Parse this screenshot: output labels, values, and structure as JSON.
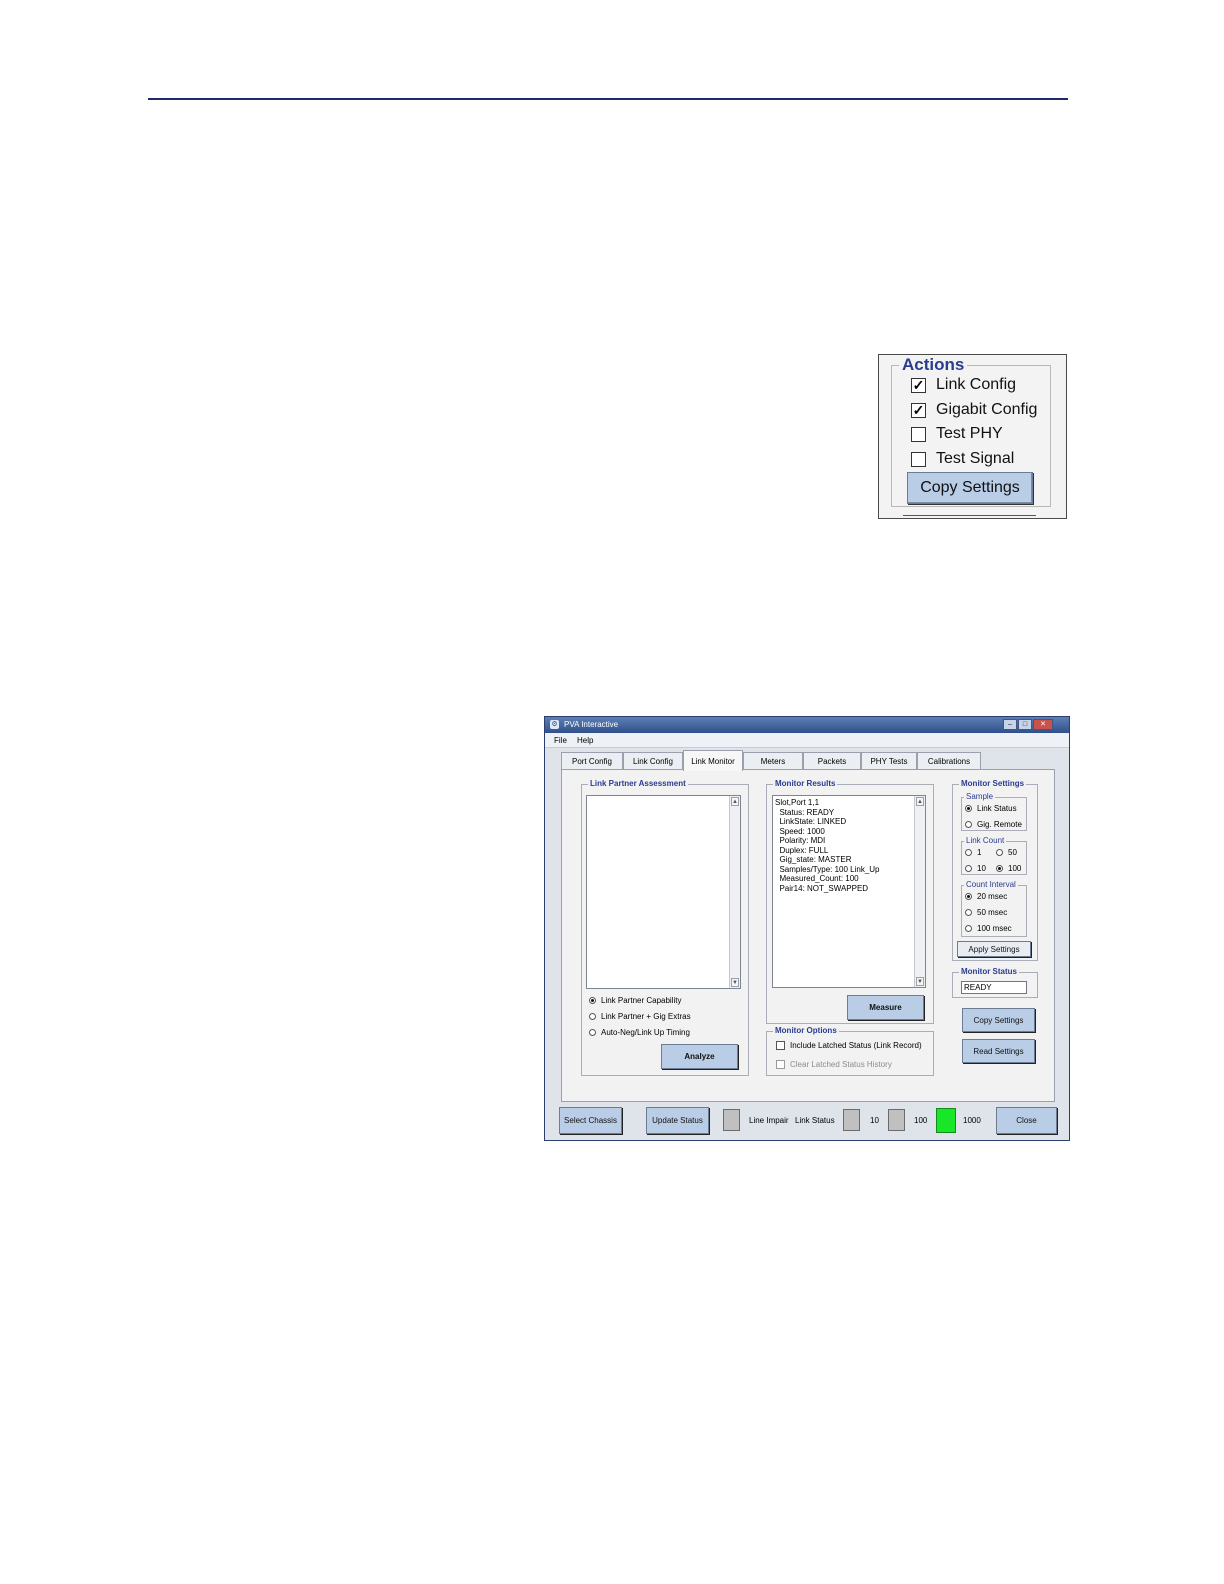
{
  "actions_panel": {
    "legend": "Actions",
    "items": [
      {
        "label": "Link Config",
        "checked": true
      },
      {
        "label": "Gigabit Config",
        "checked": true
      },
      {
        "label": "Test PHY",
        "checked": false
      },
      {
        "label": "Test Signal",
        "checked": false
      }
    ],
    "copy_button": "Copy Settings"
  },
  "window": {
    "title": "PVA Interactive",
    "menu": [
      "File",
      "Help"
    ],
    "tabs": [
      {
        "label": "Port Config",
        "active": false
      },
      {
        "label": "Link Config",
        "active": false
      },
      {
        "label": "Link Monitor",
        "active": true
      },
      {
        "label": "Meters",
        "active": false
      },
      {
        "label": "Packets",
        "active": false
      },
      {
        "label": "PHY Tests",
        "active": false
      },
      {
        "label": "Calibrations",
        "active": false
      }
    ],
    "link_partner": {
      "title": "Link Partner Assessment",
      "options": [
        {
          "label": "Link Partner Capability",
          "selected": true
        },
        {
          "label": "Link Partner + Gig Extras",
          "selected": false
        },
        {
          "label": "Auto-Neg/Link Up Timing",
          "selected": false
        }
      ],
      "analyze_button": "Analyze"
    },
    "monitor_results": {
      "title": "Monitor Results",
      "lines": [
        "Slot,Port 1,1",
        "  Status: READY",
        "  LinkState: LINKED",
        "  Speed: 1000",
        "  Polarity: MDI",
        "  Duplex: FULL",
        "  Gig_state: MASTER",
        "  Samples/Type: 100 Link_Up",
        "  Measured_Count: 100",
        "  Pair14: NOT_SWAPPED"
      ],
      "measure_button": "Measure"
    },
    "monitor_options": {
      "title": "Monitor Options",
      "include_latched": {
        "label": "Include Latched Status (Link Record)",
        "checked": false
      },
      "clear_latched": {
        "label": "Clear Latched Status History",
        "checked": false
      }
    },
    "monitor_settings": {
      "title": "Monitor Settings",
      "sample": {
        "title": "Sample",
        "options": [
          {
            "label": "Link Status",
            "selected": true
          },
          {
            "label": "Gig. Remote",
            "selected": false
          }
        ]
      },
      "link_count": {
        "title": "Link Count",
        "options": [
          {
            "label": "1",
            "selected": false
          },
          {
            "label": "50",
            "selected": false
          },
          {
            "label": "10",
            "selected": false
          },
          {
            "label": "100",
            "selected": true
          }
        ]
      },
      "count_interval": {
        "title": "Count Interval",
        "options": [
          {
            "label": "20 msec",
            "selected": true
          },
          {
            "label": "50 msec",
            "selected": false
          },
          {
            "label": "100 msec",
            "selected": false
          }
        ]
      },
      "apply_button": "Apply Settings"
    },
    "monitor_status": {
      "title": "Monitor Status",
      "value": "READY"
    },
    "copy_settings_button": "Copy Settings",
    "read_settings_button": "Read Settings",
    "statusbar": {
      "select_chassis": "Select Chassis",
      "update_status": "Update Status",
      "line_impair": "Line Impair",
      "link_status": "Link Status",
      "speed_10": "10",
      "speed_100": "100",
      "speed_1000": "1000",
      "close": "Close",
      "active_color": "#17e629"
    }
  }
}
